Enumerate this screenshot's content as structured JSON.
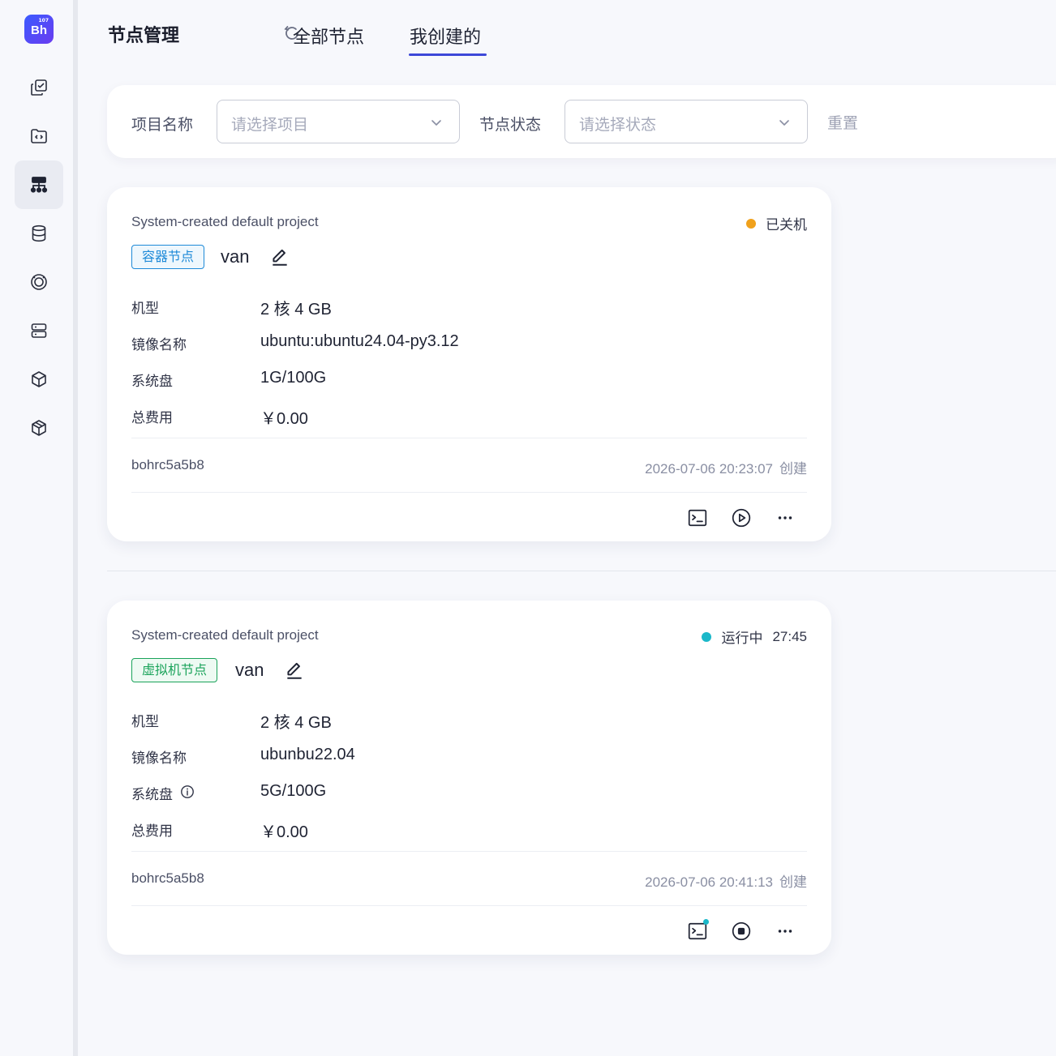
{
  "app": {
    "logo_text": "Bh",
    "logo_sup": "107"
  },
  "sidebar": {
    "items": [
      {
        "icon": "copy-check-icon"
      },
      {
        "icon": "code-folder-icon"
      },
      {
        "icon": "node-tree-icon",
        "active": true
      },
      {
        "icon": "database-icon"
      },
      {
        "icon": "target-ring-icon"
      },
      {
        "icon": "server-icon"
      },
      {
        "icon": "cube-icon"
      },
      {
        "icon": "package-icon"
      }
    ]
  },
  "header": {
    "title": "节点管理",
    "tabs": [
      {
        "label": "全部节点",
        "active": false
      },
      {
        "label": "我创建的",
        "active": true
      }
    ]
  },
  "filters": {
    "project_label": "项目名称",
    "project_placeholder": "请选择项目",
    "status_label": "节点状态",
    "status_placeholder": "请选择状态",
    "reset_label": "重置"
  },
  "fields": {
    "machine": "机型",
    "image": "镜像名称",
    "disk": "系统盘",
    "cost": "总费用"
  },
  "nodes": [
    {
      "project": "System-created default project",
      "status": "已关机",
      "status_color": "#f0a11c",
      "status_extra": "",
      "type": "容器节点",
      "name": "van",
      "machine": "2 核 4 GB",
      "image": "ubuntu:ubuntu24.04-py3.12",
      "disk": "1G/100G",
      "cost": "￥0.00",
      "owner": "bohrc5a5b8",
      "created_at": "2026-07-06 20:23:07",
      "created_label": "创建"
    },
    {
      "project": "System-created default project",
      "status": "运行中",
      "status_color": "#1bb8c9",
      "status_extra": "27:45",
      "type": "虚拟机节点",
      "name": "van",
      "machine": "2 核 4 GB",
      "image": "ubunbu22.04",
      "disk": "5G/100G",
      "cost": "￥0.00",
      "owner": "bohrc5a5b8",
      "created_at": "2026-07-06 20:41:13",
      "created_label": "创建"
    }
  ]
}
